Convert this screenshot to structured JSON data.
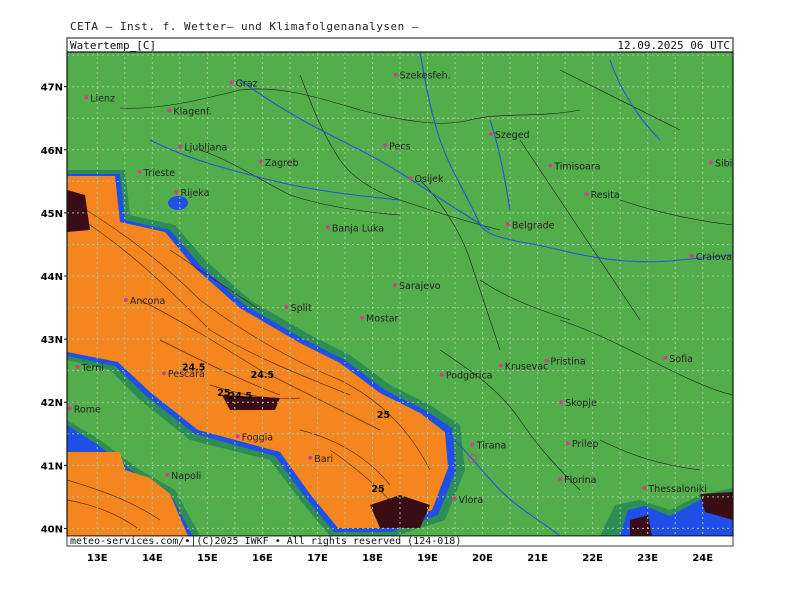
{
  "header": {
    "source": "CETA — Inst. f. Wetter– und Klimafolgenanalysen —",
    "param": "Watertemp_[C]",
    "datetime": "12.09.2025 06 UTC"
  },
  "footer": "meteo-services.com/•|(C)2025 IWKF • All rights reserved (124-018)",
  "colors": {
    "land": "#52ad4b",
    "sea_warm": "#f5861f",
    "sea_cool": "#1f4fe6",
    "sea_dark": "#3a0d16",
    "coast_green": "#2e8d55",
    "grid": "#a8c8a0",
    "city_dot": "#d0408a",
    "border": "#1a1a1a",
    "river": "#2257d6"
  },
  "axes": {
    "lat_labels": [
      "47N",
      "46N",
      "45N",
      "44N",
      "43N",
      "42N",
      "41N",
      "40N"
    ],
    "lon_labels": [
      "13E",
      "14E",
      "15E",
      "16E",
      "17E",
      "18E",
      "19E",
      "20E",
      "21E",
      "22E",
      "23E",
      "24E"
    ]
  },
  "cities": [
    {
      "name": "Lienz",
      "lon": 12.8,
      "lat": 46.83
    },
    {
      "name": "Graz",
      "lon": 15.44,
      "lat": 47.07
    },
    {
      "name": "Szekesfeh.",
      "lon": 18.42,
      "lat": 47.19
    },
    {
      "name": "Klagenf.",
      "lon": 14.31,
      "lat": 46.62
    },
    {
      "name": "Szeged",
      "lon": 20.15,
      "lat": 46.25
    },
    {
      "name": "Ljubljana",
      "lon": 14.51,
      "lat": 46.05
    },
    {
      "name": "Pecs",
      "lon": 18.23,
      "lat": 46.07
    },
    {
      "name": "Trieste",
      "lon": 13.77,
      "lat": 45.65
    },
    {
      "name": "Zagreb",
      "lon": 15.97,
      "lat": 45.81
    },
    {
      "name": "Timisoara",
      "lon": 21.23,
      "lat": 45.75
    },
    {
      "name": "Sibiu",
      "lon": 24.15,
      "lat": 45.8
    },
    {
      "name": "Rijeka",
      "lon": 14.44,
      "lat": 45.33
    },
    {
      "name": "Osijek",
      "lon": 18.69,
      "lat": 45.55
    },
    {
      "name": "Resita",
      "lon": 21.89,
      "lat": 45.3
    },
    {
      "name": "Belgrade",
      "lon": 20.46,
      "lat": 44.82
    },
    {
      "name": "Banja Luka",
      "lon": 17.19,
      "lat": 44.77
    },
    {
      "name": "Craiova",
      "lon": 23.8,
      "lat": 44.32
    },
    {
      "name": "Ancona",
      "lon": 13.52,
      "lat": 43.62
    },
    {
      "name": "Sarajevo",
      "lon": 18.41,
      "lat": 43.86
    },
    {
      "name": "Split",
      "lon": 16.44,
      "lat": 43.51
    },
    {
      "name": "Mostar",
      "lon": 17.81,
      "lat": 43.34
    },
    {
      "name": "Terni",
      "lon": 12.64,
      "lat": 42.56
    },
    {
      "name": "Pescara",
      "lon": 14.21,
      "lat": 42.46
    },
    {
      "name": "Pristina",
      "lon": 21.16,
      "lat": 42.66
    },
    {
      "name": "Sofia",
      "lon": 23.32,
      "lat": 42.7
    },
    {
      "name": "Podgorica",
      "lon": 19.26,
      "lat": 42.44
    },
    {
      "name": "Krusevac",
      "lon": 20.33,
      "lat": 42.58
    },
    {
      "name": "Skopje",
      "lon": 21.43,
      "lat": 42.0
    },
    {
      "name": "Rome",
      "lon": 12.5,
      "lat": 41.9
    },
    {
      "name": "Foggia",
      "lon": 15.55,
      "lat": 41.46
    },
    {
      "name": "Tirana",
      "lon": 19.82,
      "lat": 41.33
    },
    {
      "name": "Prilep",
      "lon": 21.55,
      "lat": 41.35
    },
    {
      "name": "Bari",
      "lon": 16.87,
      "lat": 41.12
    },
    {
      "name": "Napoli",
      "lon": 14.27,
      "lat": 40.85
    },
    {
      "name": "Florina",
      "lon": 21.41,
      "lat": 40.78
    },
    {
      "name": "Thessaloniki",
      "lon": 22.94,
      "lat": 40.64
    },
    {
      "name": "Vlora",
      "lon": 19.49,
      "lat": 40.47
    }
  ],
  "contour_labels": [
    {
      "text": "24.5",
      "lon": 14.75,
      "lat": 42.5
    },
    {
      "text": "24.5",
      "lon": 16.0,
      "lat": 42.38
    },
    {
      "text": "25",
      "lon": 15.3,
      "lat": 42.1
    },
    {
      "text": "24.5",
      "lon": 15.6,
      "lat": 42.05
    },
    {
      "text": "25",
      "lon": 18.2,
      "lat": 41.75
    },
    {
      "text": "25",
      "lon": 18.1,
      "lat": 40.58
    }
  ]
}
